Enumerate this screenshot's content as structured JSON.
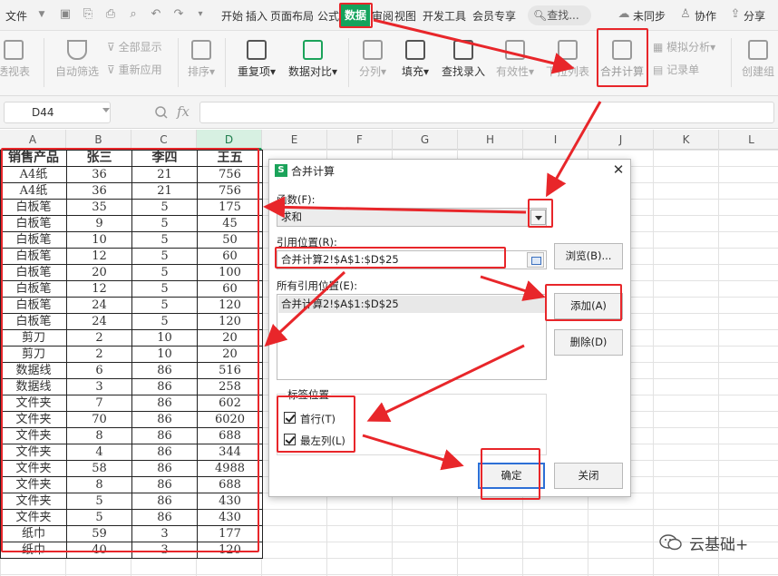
{
  "menu": {
    "file": "文件",
    "tabs": [
      "开始",
      "插入",
      "页面布局",
      "公式",
      "数据",
      "审阅",
      "视图",
      "开发工具",
      "会员专享"
    ],
    "search": "查找...",
    "unsync": "未同步",
    "collab": "协作",
    "share": "分享"
  },
  "ribbon": {
    "pivot": "透视表",
    "autofilter": "自动筛选",
    "show_all": "全部显示",
    "reapply": "重新应用",
    "sort": "排序",
    "dup": "重复项",
    "compare": "数据对比",
    "split": "分列",
    "fill": "填充",
    "lookup_entry": "查找录入",
    "validity": "有效性",
    "dropdown": "下拉列表",
    "consolidate": "合并计算",
    "simulate": "模拟分析",
    "record": "记录单",
    "create_group": "创建组"
  },
  "formula_bar": {
    "cell_ref": "D44",
    "fx": "fx",
    "formula": ""
  },
  "columns": [
    "A",
    "B",
    "C",
    "D",
    "E",
    "F",
    "G",
    "H",
    "I",
    "J",
    "K",
    "L"
  ],
  "table": {
    "headers": [
      "销售产品",
      "张三",
      "李四",
      "王五"
    ],
    "rows": [
      [
        "A4纸",
        "36",
        "21",
        "756"
      ],
      [
        "A4纸",
        "36",
        "21",
        "756"
      ],
      [
        "白板笔",
        "35",
        "5",
        "175"
      ],
      [
        "白板笔",
        "9",
        "5",
        "45"
      ],
      [
        "白板笔",
        "10",
        "5",
        "50"
      ],
      [
        "白板笔",
        "12",
        "5",
        "60"
      ],
      [
        "白板笔",
        "20",
        "5",
        "100"
      ],
      [
        "白板笔",
        "12",
        "5",
        "60"
      ],
      [
        "白板笔",
        "24",
        "5",
        "120"
      ],
      [
        "白板笔",
        "24",
        "5",
        "120"
      ],
      [
        "剪刀",
        "2",
        "10",
        "20"
      ],
      [
        "剪刀",
        "2",
        "10",
        "20"
      ],
      [
        "数据线",
        "6",
        "86",
        "516"
      ],
      [
        "数据线",
        "3",
        "86",
        "258"
      ],
      [
        "文件夹",
        "7",
        "86",
        "602"
      ],
      [
        "文件夹",
        "70",
        "86",
        "6020"
      ],
      [
        "文件夹",
        "8",
        "86",
        "688"
      ],
      [
        "文件夹",
        "4",
        "86",
        "344"
      ],
      [
        "文件夹",
        "58",
        "86",
        "4988"
      ],
      [
        "文件夹",
        "8",
        "86",
        "688"
      ],
      [
        "文件夹",
        "5",
        "86",
        "430"
      ],
      [
        "文件夹",
        "5",
        "86",
        "430"
      ],
      [
        "纸巾",
        "59",
        "3",
        "177"
      ],
      [
        "纸巾",
        "40",
        "3",
        "120"
      ]
    ]
  },
  "dialog": {
    "title": "合并计算",
    "function_label": "函数(F):",
    "function_value": "求和",
    "ref_label": "引用位置(R):",
    "ref_value": "合并计算2!$A$1:$D$25",
    "browse": "浏览(B)...",
    "all_refs_label": "所有引用位置(E):",
    "all_refs": [
      "合并计算2!$A$1:$D$25"
    ],
    "add": "添加(A)",
    "delete": "删除(D)",
    "label_pos": "标签位置",
    "first_row": "首行(T)",
    "first_row_checked": true,
    "left_col": "最左列(L)",
    "left_col_checked": true,
    "ok": "确定",
    "close": "关闭"
  },
  "watermark": "云基础+",
  "colors": {
    "accent": "#14a35c",
    "annotation": "#e8262a",
    "ok_border": "#2d6fd6"
  }
}
